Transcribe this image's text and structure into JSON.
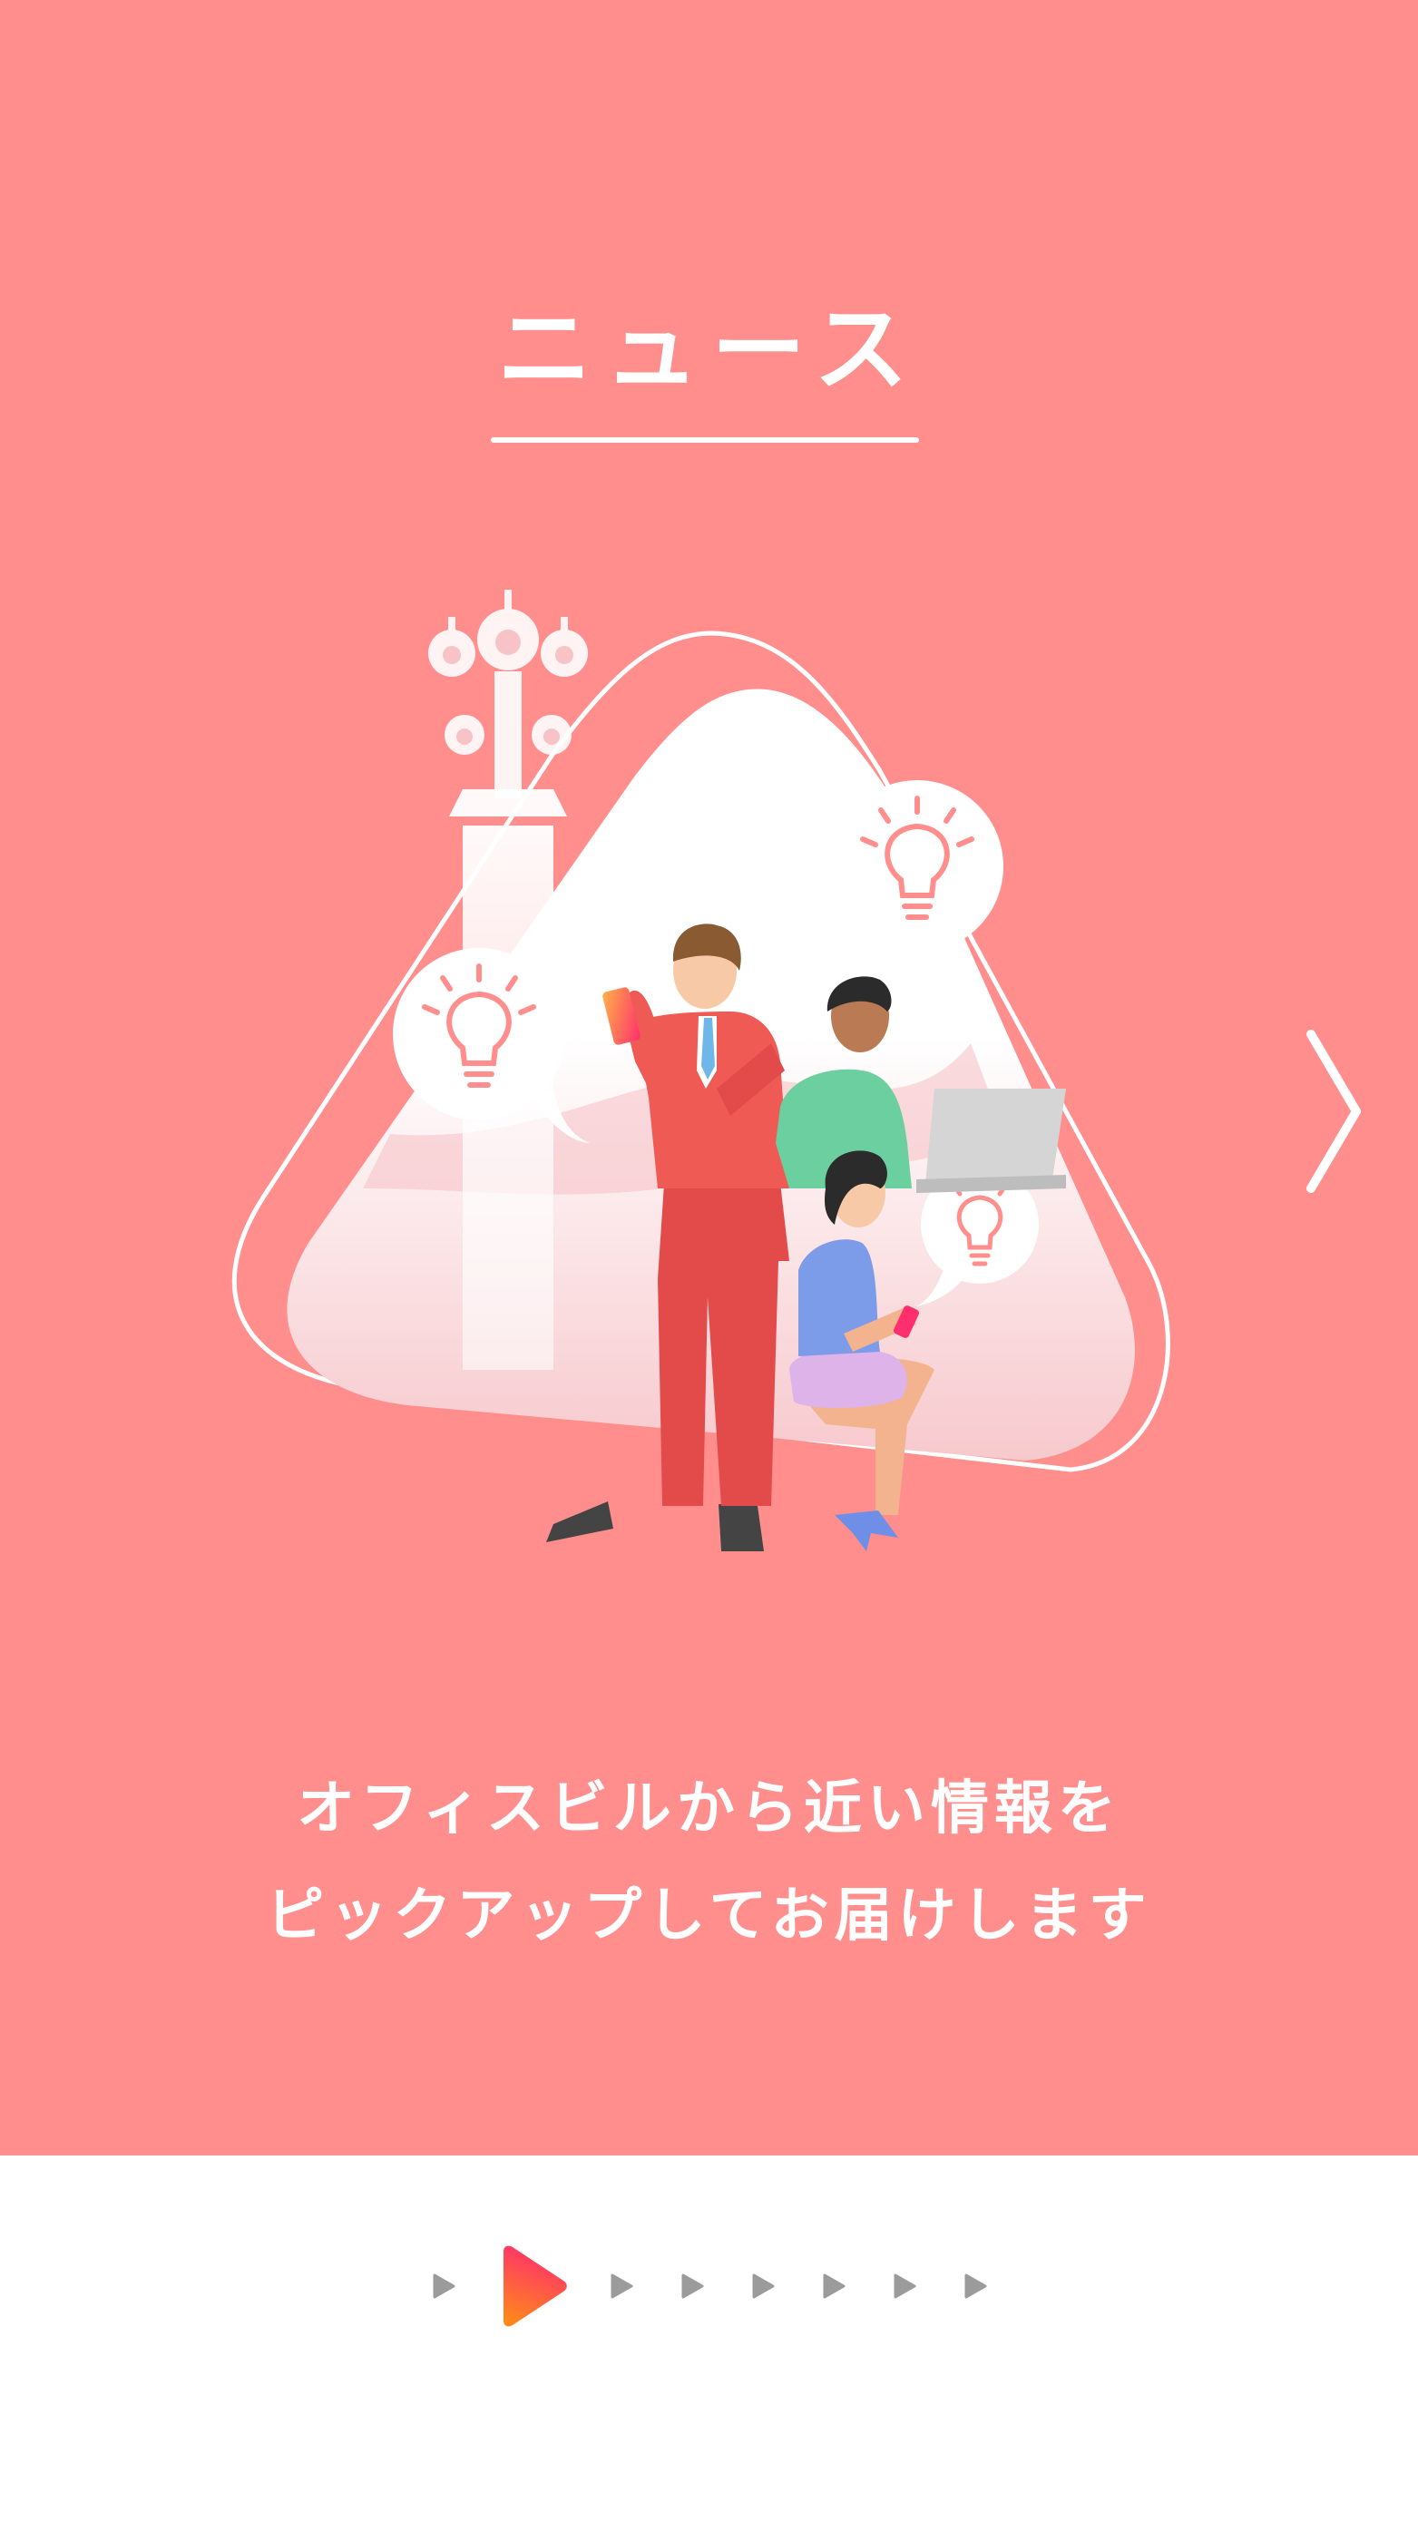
{
  "onboarding": {
    "title": "ニュース",
    "description_lines": [
      "オフィスビルから近い情報を",
      "ピックアップしてお届けします"
    ],
    "background_color": "#FF8E8C",
    "next_icon": "chevron-right-icon"
  },
  "pager": {
    "total_pages": 8,
    "current_page": 2,
    "indicator_icon": "play-triangle-icon",
    "inactive_color": "#9B9B9B",
    "active_gradient": [
      "#FF2E6E",
      "#FF8A1A"
    ]
  }
}
